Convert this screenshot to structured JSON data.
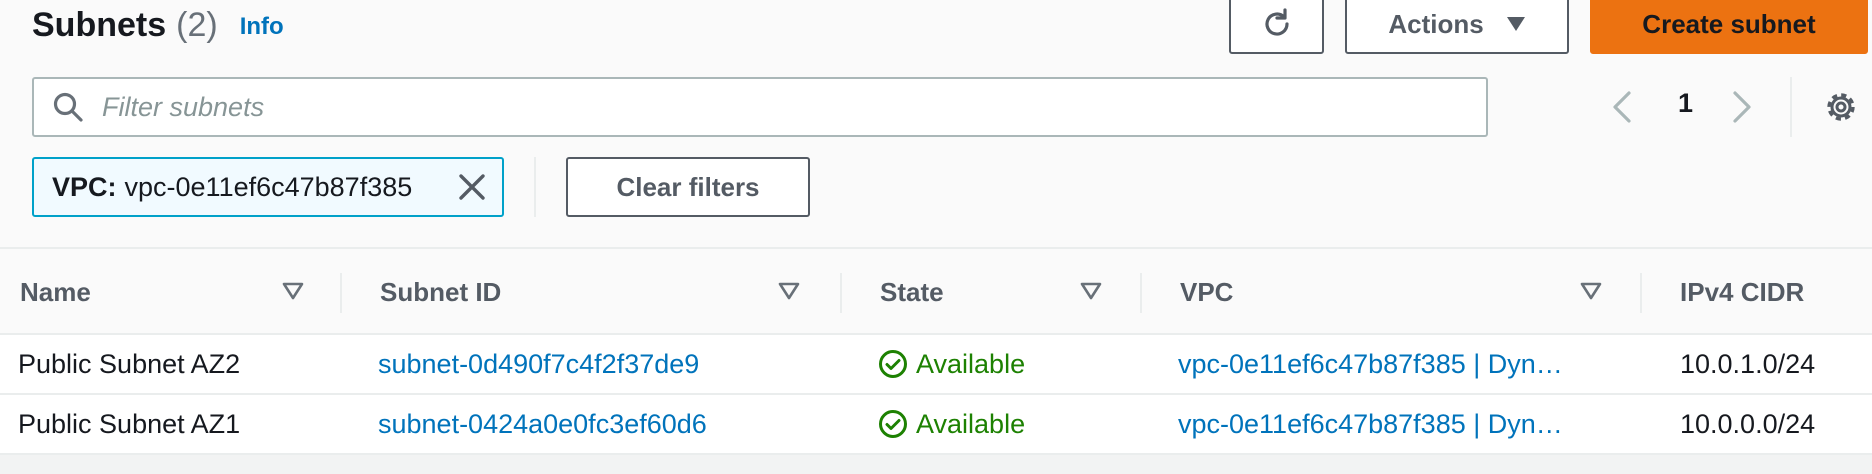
{
  "header": {
    "title": "Subnets",
    "count": "(2)",
    "info_label": "Info",
    "actions_label": "Actions",
    "create_label": "Create subnet"
  },
  "search": {
    "placeholder": "Filter subnets",
    "value": ""
  },
  "pagination": {
    "current_page": "1"
  },
  "filters": {
    "token_key": "VPC:",
    "token_value": "vpc-0e11ef6c47b87f385",
    "clear_label": "Clear filters"
  },
  "table": {
    "columns": [
      "Name",
      "Subnet ID",
      "State",
      "VPC",
      "IPv4 CIDR"
    ],
    "rows": [
      {
        "name": "Public Subnet AZ2",
        "subnet_id": "subnet-0d490f7c4f2f37de9",
        "state": "Available",
        "vpc": "vpc-0e11ef6c47b87f385 | Dyn…",
        "cidr": "10.0.1.0/24"
      },
      {
        "name": "Public Subnet AZ1",
        "subnet_id": "subnet-0424a0e0fc3ef60d6",
        "state": "Available",
        "vpc": "vpc-0e11ef6c47b87f385 | Dyn…",
        "cidr": "10.0.0.0/24"
      }
    ]
  },
  "icons": {
    "refresh": "refresh-icon",
    "caret": "caret-down-icon",
    "search": "search-icon",
    "prev": "chevron-left-icon",
    "next": "chevron-right-icon",
    "settings": "gear-icon",
    "dismiss": "close-icon",
    "sort": "sort-down-icon",
    "status": "check-circle-icon"
  },
  "colors": {
    "primary": "#ec7211",
    "link": "#0073bb",
    "success": "#1d8102",
    "token_border": "#00a1c9"
  }
}
